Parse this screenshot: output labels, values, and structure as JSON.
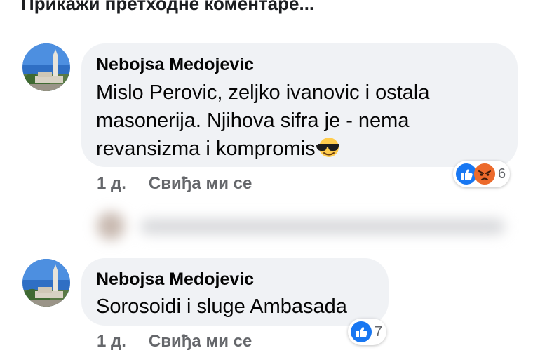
{
  "prev_comments_link": "Прикажи претходне коментаре...",
  "colors": {
    "bubble_bg": "#f0f2f5",
    "like_blue": "#1877f2",
    "angry_orange": "#f28b2c",
    "meta_gray": "#65676b"
  },
  "comments": [
    {
      "author": "Nebojsa Medojevic",
      "lines": [
        "Mislo Perovic, zeljko ivanovic  i ostala",
        "masonerija. Njihova sifra je - nema",
        "revansizma i kompromis"
      ],
      "inline_emoji": "sunglasses-emoji",
      "time": "1 д.",
      "like_label": "Свиђа ми се",
      "reactions": [
        "like-icon",
        "angry-icon"
      ],
      "reaction_count": "6"
    },
    {
      "author": "Nebojsa Medojevic",
      "lines": [
        "Sorosoidi i sluge Ambasada"
      ],
      "time": "1 д.",
      "like_label": "Свиђа ми се",
      "reactions": [
        "like-icon"
      ],
      "reaction_count": "7"
    }
  ]
}
